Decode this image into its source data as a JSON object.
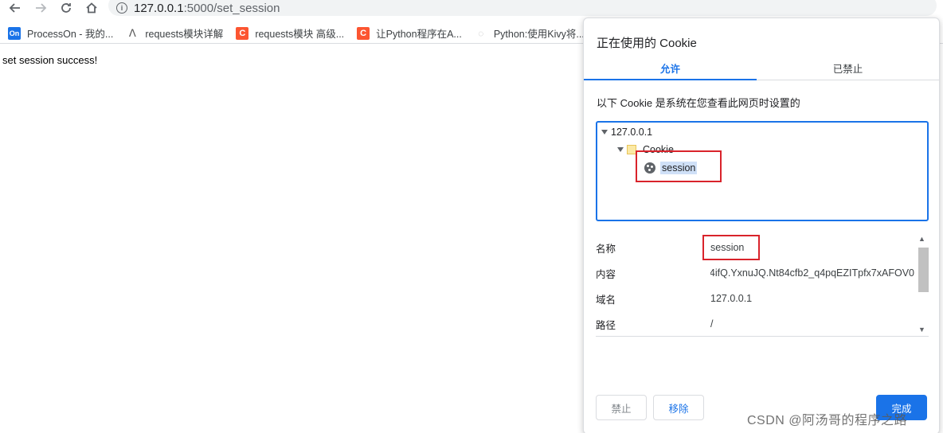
{
  "browser": {
    "url_host": "127.0.0.1",
    "url_path": ":5000/set_session",
    "info_icon": "i"
  },
  "bookmarks": [
    {
      "icon_text": "On",
      "label": "ProcessOn - 我的..."
    },
    {
      "icon_text": "ꓥ",
      "label": "requests模块详解"
    },
    {
      "icon_text": "C",
      "label": "requests模块 高级..."
    },
    {
      "icon_text": "C",
      "label": "让Python程序在A..."
    },
    {
      "icon_text": "◌",
      "label": "Python:使用Kivy将..."
    }
  ],
  "page": {
    "text": "set session success!"
  },
  "dialog": {
    "title": "正在使用的 Cookie",
    "tabs": [
      {
        "label": "允许"
      },
      {
        "label": "已禁止"
      }
    ],
    "description": "以下 Cookie 是系统在您查看此网页时设置的",
    "tree": {
      "host": "127.0.0.1",
      "folder": "Cookie",
      "cookie": "session"
    },
    "details": [
      {
        "key": "名称",
        "value": "session"
      },
      {
        "key": "内容",
        "value": "4ifQ.YxnuJQ.Nt84cfb2_q4pqEZITpfx7xAFOV0"
      },
      {
        "key": "域名",
        "value": "127.0.0.1"
      },
      {
        "key": "路径",
        "value": "/"
      }
    ],
    "buttons": {
      "block": "禁止",
      "remove": "移除",
      "done": "完成"
    }
  },
  "watermark": "CSDN @阿汤哥的程序之路"
}
